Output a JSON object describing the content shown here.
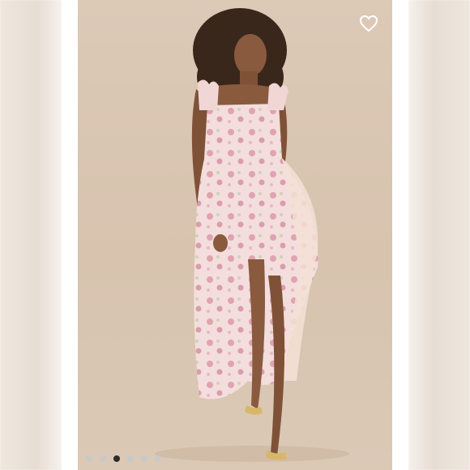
{
  "listing": {
    "photo_alt": "",
    "favorite_icon": "heart-outline-icon",
    "favorite_color": "#ffffff",
    "carousel": {
      "total": 6,
      "active_index": 2,
      "active_color": "#2c2c2c",
      "inactive_color": "#c9c9c9"
    }
  }
}
